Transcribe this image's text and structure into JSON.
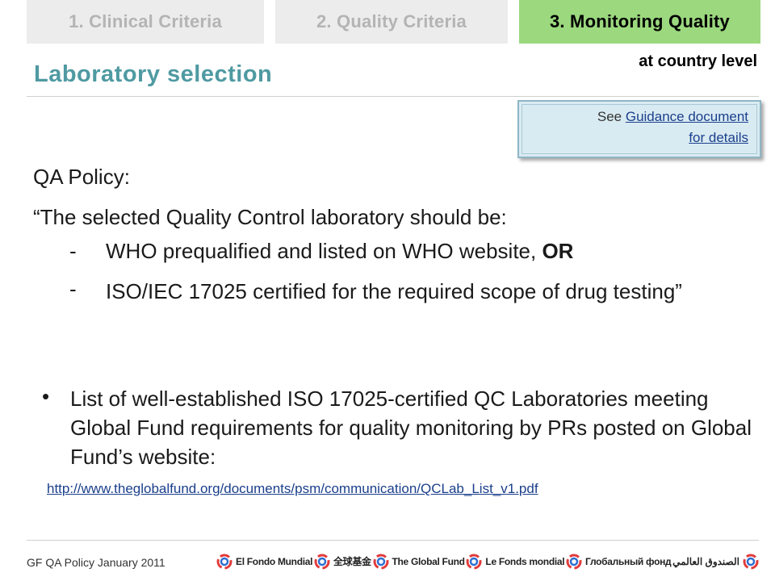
{
  "tabs": [
    {
      "label": "1. Clinical Criteria"
    },
    {
      "label": "2. Quality Criteria"
    },
    {
      "label": "3. Monitoring Quality"
    }
  ],
  "subtab": "at country level",
  "title": "Laboratory selection",
  "guidance": {
    "prefix": "See ",
    "link_line1": "Guidance document",
    "link_line2": "for details"
  },
  "content": {
    "qa_label": "QA Policy:",
    "quote_intro": "“The selected Quality Control laboratory should be:",
    "dash": "-",
    "item1_text": "WHO prequalified and listed on WHO website, ",
    "item1_emph": "OR",
    "item2_text": "ISO/IEC 17025 certified for the required  scope of drug testing”",
    "bullet": "•",
    "bullet_text": "List of well-established ISO 17025-certified QC Laboratories meeting Global Fund requirements for quality monitoring by PRs posted on Global Fund’s website:",
    "url": "http://www.theglobalfund.org/documents/psm/communication/QCLab_List_v1.pdf"
  },
  "footer": "GF QA Policy January 2011",
  "logos": [
    {
      "name": "El Fondo Mundial",
      "icon": "global-fund-icon"
    },
    {
      "name": "全球基金",
      "icon": "global-fund-icon"
    },
    {
      "name": "The Global Fund",
      "icon": "global-fund-icon"
    },
    {
      "name": "Le Fonds mondial",
      "icon": "global-fund-icon"
    },
    {
      "name": "Глобальный фонд",
      "icon": "global-fund-icon"
    },
    {
      "name": "الصندوق العالمي",
      "icon": "global-fund-icon"
    }
  ],
  "colors": {
    "tab_inactive_bg": "#ececec",
    "tab_inactive_text": "#b4b4b4",
    "tab_active_bg": "#9bd87e",
    "title": "#4f9aa2",
    "link": "#1b3f8c",
    "guidance_bg": "#d9ebf2"
  }
}
